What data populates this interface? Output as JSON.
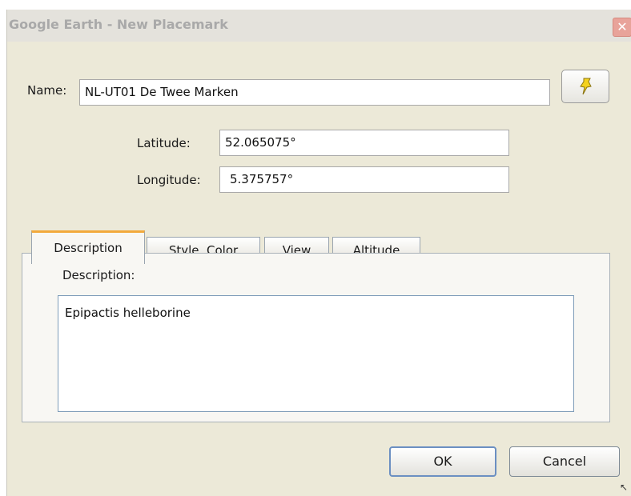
{
  "window": {
    "title": "Google Earth - New Placemark",
    "close_glyph": "✕"
  },
  "form": {
    "name_label": "Name:",
    "name_value": "NL-UT01 De Twee Marken",
    "latitude_label": "Latitude:",
    "latitude_value": "52.065075°",
    "longitude_label": "Longitude:",
    "longitude_value": "5.375757°",
    "pin_icon": "yellow-pushpin-icon"
  },
  "tabs": [
    {
      "label": "Description",
      "active": true
    },
    {
      "label": "Style, Color",
      "active": false
    },
    {
      "label": "View",
      "active": false
    },
    {
      "label": "Altitude",
      "active": false
    }
  ],
  "description": {
    "label": "Description:",
    "value": "Epipactis helleborine"
  },
  "buttons": {
    "ok": "OK",
    "cancel": "Cancel"
  },
  "colors": {
    "active_tab_accent": "#f2a93b",
    "pin_yellow": "#f4d21f"
  }
}
